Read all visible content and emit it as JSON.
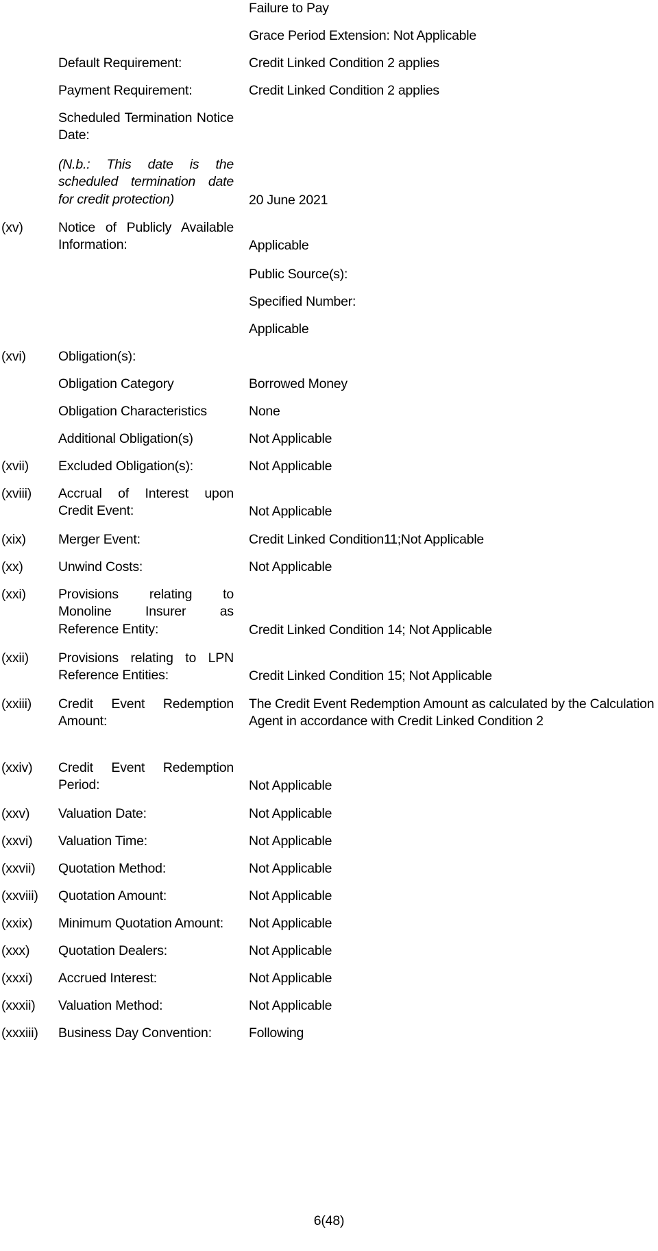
{
  "document": {
    "page_number": "6(48)",
    "footer_text": "6(48)"
  },
  "rows": [
    {
      "roman": "",
      "label": "",
      "value": "Failure to Pay"
    },
    {
      "roman": "",
      "label": "",
      "value": "Grace Period Extension: Not Applicable"
    },
    {
      "roman": "",
      "label": "Default Requirement:",
      "value": "Credit Linked Condition 2 applies"
    },
    {
      "roman": "",
      "label": "Payment Requirement:",
      "value": "Credit Linked Condition 2 applies"
    },
    {
      "roman": "",
      "label": "Scheduled Termination Notice Date:",
      "value": ""
    },
    {
      "roman": "",
      "label": "(N.b.: This date is the scheduled termination date for credit protection)",
      "value": "20 June 2021"
    },
    {
      "roman": "(xv)",
      "label": "Notice of Publicly Available Information:",
      "value": "Applicable"
    },
    {
      "roman": "",
      "label": "",
      "value": "Public Source(s):"
    },
    {
      "roman": "",
      "label": "",
      "value": "Specified Number:"
    },
    {
      "roman": "",
      "label": "",
      "value": "Applicable"
    },
    {
      "roman": "(xvi)",
      "label": "Obligation(s):",
      "value": ""
    },
    {
      "roman": "",
      "label": "Obligation Category",
      "value": "Borrowed Money"
    },
    {
      "roman": "",
      "label": "Obligation Characteristics",
      "value": "None"
    },
    {
      "roman": "",
      "label": "Additional Obligation(s)",
      "value": "Not Applicable"
    },
    {
      "roman": "(xvii)",
      "label": "Excluded Obligation(s):",
      "value": "Not Applicable"
    },
    {
      "roman": "(xviii)",
      "label": "Accrual of Interest upon Credit Event:",
      "value": "Not Applicable"
    },
    {
      "roman": "(xix)",
      "label": "Merger Event:",
      "value": "Credit Linked Condition11;Not Applicable"
    },
    {
      "roman": "(xx)",
      "label": "Unwind Costs:",
      "value": "Not Applicable"
    },
    {
      "roman": "(xxi)",
      "label": "Provisions relating to Monoline Insurer as Reference Entity:",
      "value": "Credit Linked Condition 14; Not Applicable"
    },
    {
      "roman": "(xxii)",
      "label": "Provisions relating to LPN Reference Entities:",
      "value": "Credit Linked Condition 15; Not Applicable"
    },
    {
      "roman": "(xxiii)",
      "label": "Credit Event Redemption Amount:",
      "value": "The Credit Event Redemption Amount as calculated by the Calculation Agent in accordance with Credit Linked Condition 2"
    },
    {
      "roman": "(xxiv)",
      "label": "Credit Event Redemption Period:",
      "value": "Not Applicable"
    },
    {
      "roman": "(xxv)",
      "label": "Valuation Date:",
      "value": "Not Applicable"
    },
    {
      "roman": "(xxvi)",
      "label": "Valuation Time:",
      "value": "Not Applicable"
    },
    {
      "roman": "(xxvii)",
      "label": "Quotation Method:",
      "value": "Not Applicable"
    },
    {
      "roman": "(xxviii)",
      "label": "Quotation Amount:",
      "value": "Not Applicable"
    },
    {
      "roman": "(xxix)",
      "label": "Minimum Quotation Amount:",
      "value": "Not Applicable"
    },
    {
      "roman": "(xxx)",
      "label": "Quotation Dealers:",
      "value": "Not Applicable"
    },
    {
      "roman": "(xxxi)",
      "label": "Accrued Interest:",
      "value": "Not Applicable"
    },
    {
      "roman": "(xxxii)",
      "label": "Valuation Method:",
      "value": "Not Applicable"
    },
    {
      "roman": "(xxxiii)",
      "label": "Business Day Convention:",
      "value": "Following"
    }
  ]
}
